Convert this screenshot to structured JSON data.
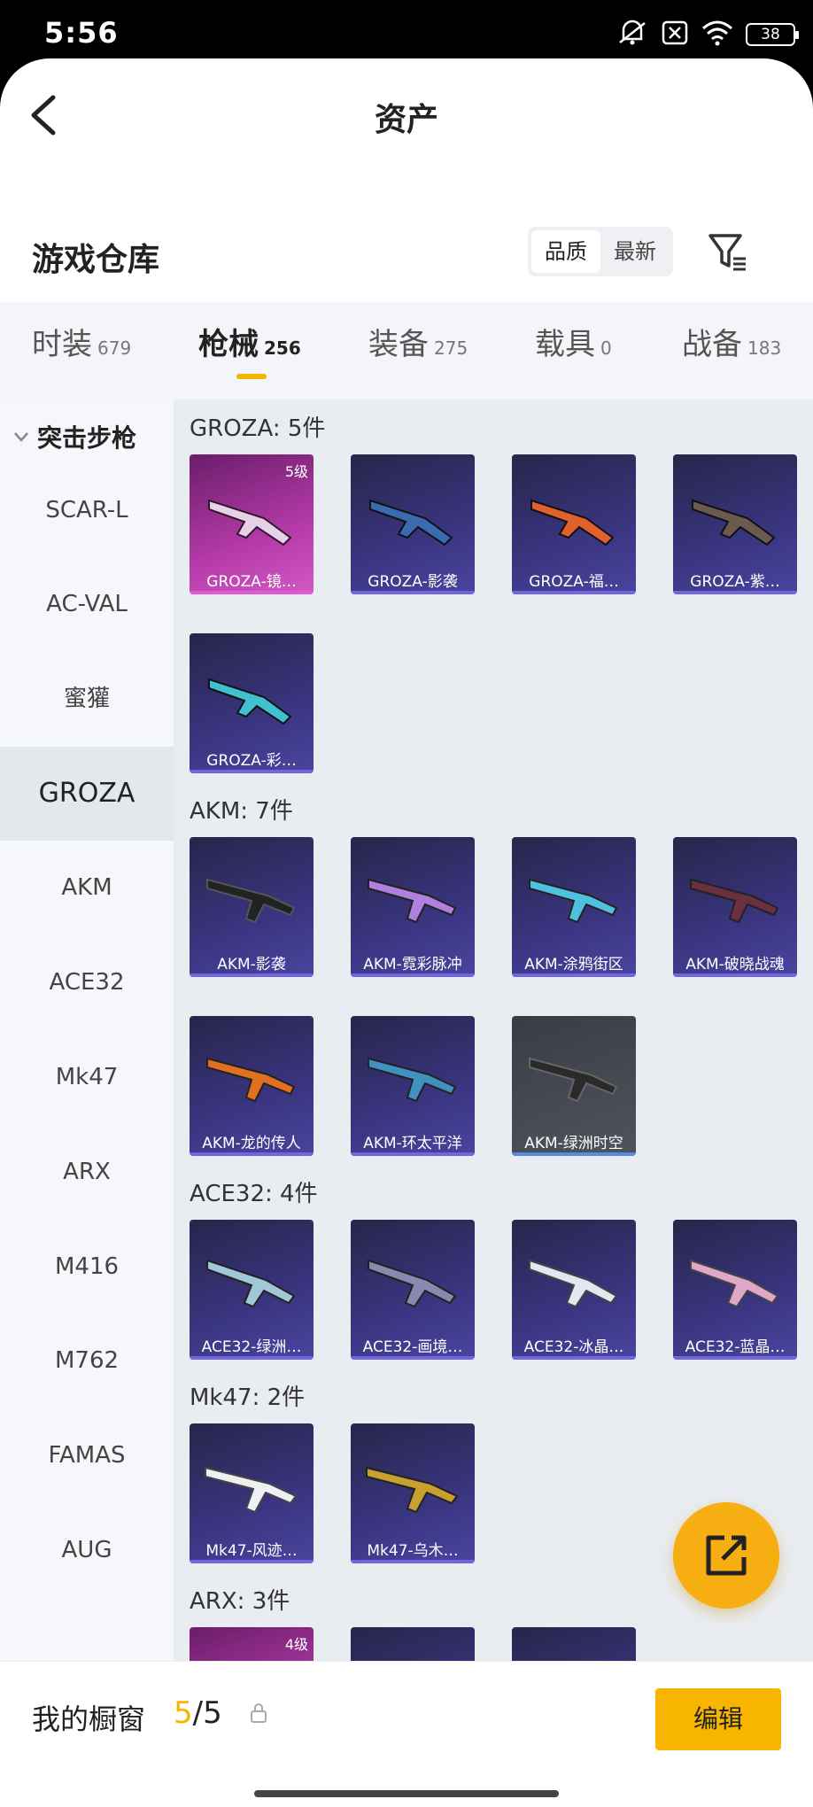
{
  "status_bar": {
    "time": "5:56",
    "battery": "38",
    "icons": [
      "mute-icon",
      "sim-off-icon",
      "wifi-icon",
      "battery-icon"
    ]
  },
  "header": {
    "title": "资产"
  },
  "warehouse": {
    "title": "游戏仓库",
    "sort_options": [
      "品质",
      "最新"
    ],
    "active_sort": "品质"
  },
  "tabs": [
    {
      "label": "时装",
      "count": "679"
    },
    {
      "label": "枪械",
      "count": "256",
      "active": true
    },
    {
      "label": "装备",
      "count": "275"
    },
    {
      "label": "载具",
      "count": "0"
    },
    {
      "label": "战备",
      "count": "183"
    }
  ],
  "sidebar": {
    "group": "突击步枪",
    "items": [
      "SCAR-L",
      "AC-VAL",
      "蜜獾",
      "GROZA",
      "AKM",
      "ACE32",
      "Mk47",
      "ARX",
      "M416",
      "M762",
      "FAMAS",
      "AUG"
    ],
    "active": "GROZA"
  },
  "sections": [
    {
      "title": "GROZA: 5件",
      "items": [
        {
          "name": "GROZA-镜…",
          "level": "5级",
          "style": "pink"
        },
        {
          "name": "GROZA-影袭"
        },
        {
          "name": "GROZA-福…"
        },
        {
          "name": "GROZA-紫…"
        },
        {
          "name": "GROZA-彩…"
        }
      ]
    },
    {
      "title": "AKM: 7件",
      "items": [
        {
          "name": "AKM-影袭"
        },
        {
          "name": "AKM-霓彩脉冲"
        },
        {
          "name": "AKM-涂鸦街区"
        },
        {
          "name": "AKM-破晓战魂"
        },
        {
          "name": "AKM-龙的传人"
        },
        {
          "name": "AKM-环太平洋"
        },
        {
          "name": "AKM-绿洲时空",
          "style": "gray"
        }
      ]
    },
    {
      "title": "ACE32: 4件",
      "items": [
        {
          "name": "ACE32-绿洲…"
        },
        {
          "name": "ACE32-画境…"
        },
        {
          "name": "ACE32-冰晶…"
        },
        {
          "name": "ACE32-蓝晶…"
        }
      ]
    },
    {
      "title": "Mk47: 2件",
      "items": [
        {
          "name": "Mk47-风迹…"
        },
        {
          "name": "Mk47-乌木…"
        }
      ]
    },
    {
      "title": "ARX: 3件",
      "items": [
        {
          "name": "",
          "level": "4级",
          "style": "pink"
        },
        {
          "name": ""
        },
        {
          "name": ""
        }
      ]
    }
  ],
  "bottom": {
    "showcase_label": "我的橱窗",
    "current": "5",
    "total": "/5",
    "edit_label": "编辑"
  },
  "colors": {
    "accent": "#f7b500",
    "card_bg": "#3a3580",
    "rare_bg": "#b43aa8"
  }
}
